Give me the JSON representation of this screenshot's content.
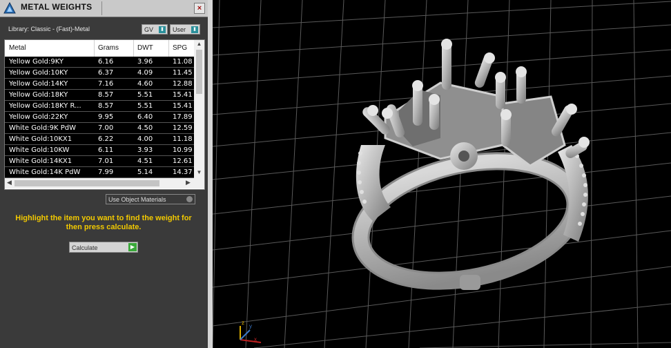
{
  "window": {
    "title": "METAL WEIGHTS",
    "close_label": "×"
  },
  "library": {
    "text": "Library: Classic - (Fast)-Metal",
    "gv_label": "GV",
    "user_label": "User"
  },
  "table": {
    "headers": [
      "Metal",
      "Grams",
      "DWT",
      "SPG"
    ],
    "rows": [
      [
        "Yellow Gold:9KY",
        "6.16",
        "3.96",
        "11.08"
      ],
      [
        "Yellow Gold:10KY",
        "6.37",
        "4.09",
        "11.45"
      ],
      [
        "Yellow Gold:14KY",
        "7.16",
        "4.60",
        "12.88"
      ],
      [
        "Yellow Gold:18KY",
        "8.57",
        "5.51",
        "15.41"
      ],
      [
        "Yellow Gold:18KY R...",
        "8.57",
        "5.51",
        "15.41"
      ],
      [
        "Yellow Gold:22KY",
        "9.95",
        "6.40",
        "17.89"
      ],
      [
        "White Gold:9K PdW",
        "7.00",
        "4.50",
        "12.59"
      ],
      [
        "White Gold:10KX1",
        "6.22",
        "4.00",
        "11.18"
      ],
      [
        "White Gold:10KW",
        "6.11",
        "3.93",
        "10.99"
      ],
      [
        "White Gold:14KX1",
        "7.01",
        "4.51",
        "12.61"
      ],
      [
        "White Gold:14K PdW",
        "7.99",
        "5.14",
        "14.37"
      ]
    ]
  },
  "options": {
    "use_object_materials": "Use Object Materials"
  },
  "hint": "Highlight the item you want to find the weight for then press calculate.",
  "calculate_label": "Calculate",
  "viewport": {
    "axis_z": "z",
    "axis_y": "y",
    "axis_x": "x"
  },
  "colors": {
    "panel_bg": "#3a3a3a",
    "hint_color": "#f2c900",
    "viewport_bg": "#000000",
    "grid": "#5a5a5a"
  }
}
